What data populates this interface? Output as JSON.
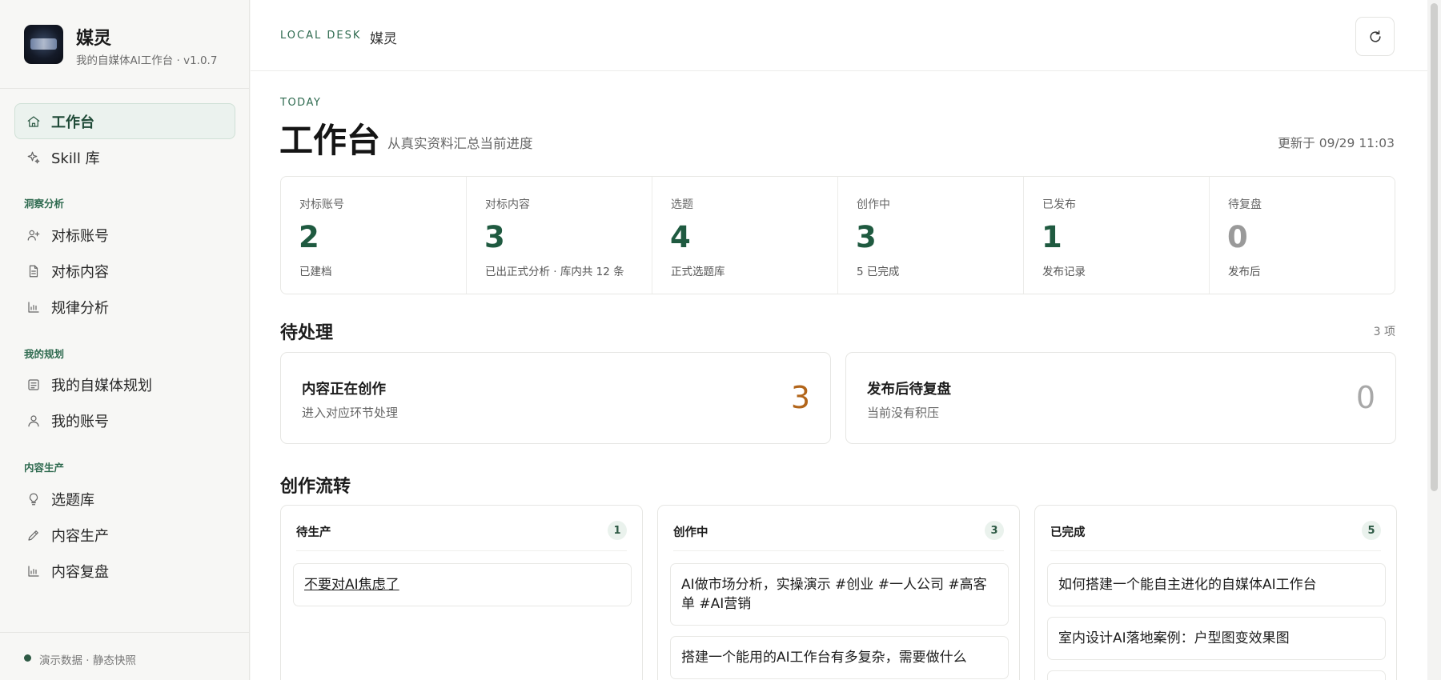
{
  "brand": {
    "name": "媒灵",
    "subtitle": "我的自媒体AI工作台 · v1.0.7"
  },
  "nav": {
    "workbench": "工作台",
    "skills": "Skill 库",
    "section_insight": "洞察分析",
    "benchmark_accounts": "对标账号",
    "benchmark_content": "对标内容",
    "pattern_analysis": "规律分析",
    "section_plan": "我的规划",
    "media_plan": "我的自媒体规划",
    "my_accounts": "我的账号",
    "section_production": "内容生产",
    "topic_library": "选题库",
    "content_production": "内容生产",
    "content_review": "内容复盘"
  },
  "footer": {
    "status": "演示数据 · 静态快照"
  },
  "topbar": {
    "kicker": "LOCAL DESK",
    "title": "媒灵"
  },
  "header": {
    "today": "TODAY",
    "title": "工作台",
    "subtitle": "从真实资料汇总当前进度",
    "updated": "更新于 09/29 11:03"
  },
  "stats": [
    {
      "label": "对标账号",
      "value": "2",
      "note": "已建档"
    },
    {
      "label": "对标内容",
      "value": "3",
      "note": "已出正式分析 · 库内共 12 条"
    },
    {
      "label": "选题",
      "value": "4",
      "note": "正式选题库"
    },
    {
      "label": "创作中",
      "value": "3",
      "note": "5 已完成"
    },
    {
      "label": "已发布",
      "value": "1",
      "note": "发布记录"
    },
    {
      "label": "待复盘",
      "value": "0",
      "note": "发布后"
    }
  ],
  "pending": {
    "title": "待处理",
    "count": "3 项",
    "cards": [
      {
        "title": "内容正在创作",
        "subtitle": "进入对应环节处理",
        "value": "3"
      },
      {
        "title": "发布后待复盘",
        "subtitle": "当前没有积压",
        "value": "0"
      }
    ]
  },
  "flow": {
    "title": "创作流转",
    "columns": [
      {
        "name": "待生产",
        "count": "1",
        "items": [
          "不要对AI焦虑了"
        ]
      },
      {
        "name": "创作中",
        "count": "3",
        "items": [
          "AI做市场分析，实操演示 #创业 #一人公司 #高客单 #AI营销",
          "搭建一个能用的AI工作台有多复杂，需要做什么"
        ]
      },
      {
        "name": "已完成",
        "count": "5",
        "items": [
          "如何搭建一个能自主进化的自媒体AI工作台",
          "室内设计AI落地案例：户型图变效果图"
        ]
      }
    ]
  },
  "colors": {
    "accent": "#2e5a45",
    "warning": "#b2651a"
  }
}
